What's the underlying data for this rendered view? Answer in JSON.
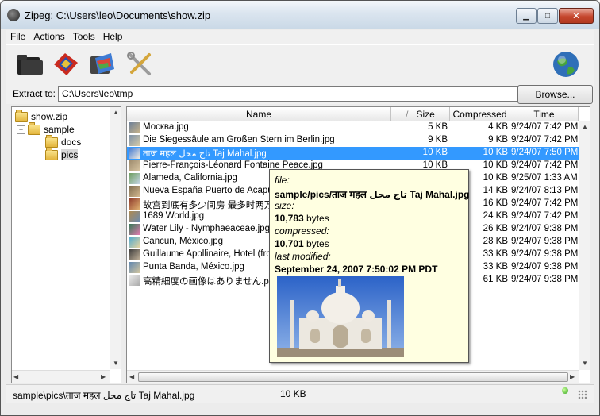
{
  "window": {
    "title": "Zipeg: C:\\Users\\leo\\Documents\\show.zip"
  },
  "menu": [
    "File",
    "Actions",
    "Tools",
    "Help"
  ],
  "toolbar": {
    "icons": [
      "open-archive-icon",
      "extract-icon",
      "extract-all-icon",
      "options-icon",
      "globe-icon"
    ]
  },
  "extract": {
    "label": "Extract to:",
    "path": "C:\\Users\\leo\\tmp",
    "browse_label": "Browse..."
  },
  "tree": {
    "root": "show.zip",
    "sample": "sample",
    "docs": "docs",
    "pics": "pics"
  },
  "columns": {
    "name": "Name",
    "size": "Size",
    "compressed": "Compressed",
    "time": "Time",
    "sort_mark": "/"
  },
  "files": [
    {
      "name": "Москва.jpg",
      "size": "5 KB",
      "compressed": "4 KB",
      "time": "9/24/07 7:42 PM"
    },
    {
      "name": "Die Siegessäule am Großen Stern im Berlin.jpg",
      "size": "9 KB",
      "compressed": "9 KB",
      "time": "9/24/07 7:42 PM"
    },
    {
      "name": "ताज महल تاج محل Taj Mahal.jpg",
      "size": "10 KB",
      "compressed": "10 KB",
      "time": "9/24/07 7:50 PM"
    },
    {
      "name": "Pierre-François-Léonard Fontaine Peace.jpg",
      "size": "10 KB",
      "compressed": "10 KB",
      "time": "9/24/07 7:42 PM"
    },
    {
      "name": "Alameda, California.jpg",
      "size": "",
      "compressed": "10 KB",
      "time": "9/25/07 1:33 AM"
    },
    {
      "name": "Nueva España Puerto de Acapulco",
      "size": "",
      "compressed": "14 KB",
      "time": "9/24/07 8:13 PM"
    },
    {
      "name": "故宫到底有多少间房 最多时两万",
      "size": "",
      "compressed": "16 KB",
      "time": "9/24/07 7:42 PM"
    },
    {
      "name": "1689 World.jpg",
      "size": "",
      "compressed": "24 KB",
      "time": "9/24/07 7:42 PM"
    },
    {
      "name": "Water Lily - Nymphaeaceae.jpg",
      "size": "",
      "compressed": "26 KB",
      "time": "9/24/07 9:38 PM"
    },
    {
      "name": "Cancun, México.jpg",
      "size": "",
      "compressed": "28 KB",
      "time": "9/24/07 9:38 PM"
    },
    {
      "name": "Guillaume Apollinaire, Hotel (from",
      "size": "",
      "compressed": "33 KB",
      "time": "9/24/07 9:38 PM"
    },
    {
      "name": "Punta Banda, México.jpg",
      "size": "",
      "compressed": "33 KB",
      "time": "9/24/07 9:38 PM"
    },
    {
      "name": "高精細度の画像はありません.pn",
      "size": "",
      "compressed": "61 KB",
      "time": "9/24/07 9:38 PM"
    }
  ],
  "tooltip": {
    "file_label": "file:",
    "file_value": "sample/pics/ताज महल تاج محل Taj Mahal.jpg",
    "size_label": "size:",
    "size_value": "10,783",
    "size_unit": "bytes",
    "compressed_label": "compressed:",
    "compressed_value": "10,701",
    "compressed_unit": "bytes",
    "modified_label": "last modified:",
    "modified_value": "September 24, 2007 7:50:02 PM PDT"
  },
  "status": {
    "path": "sample\\pics\\ताज महल تاج محل Taj Mahal.jpg",
    "size": "10 KB"
  }
}
